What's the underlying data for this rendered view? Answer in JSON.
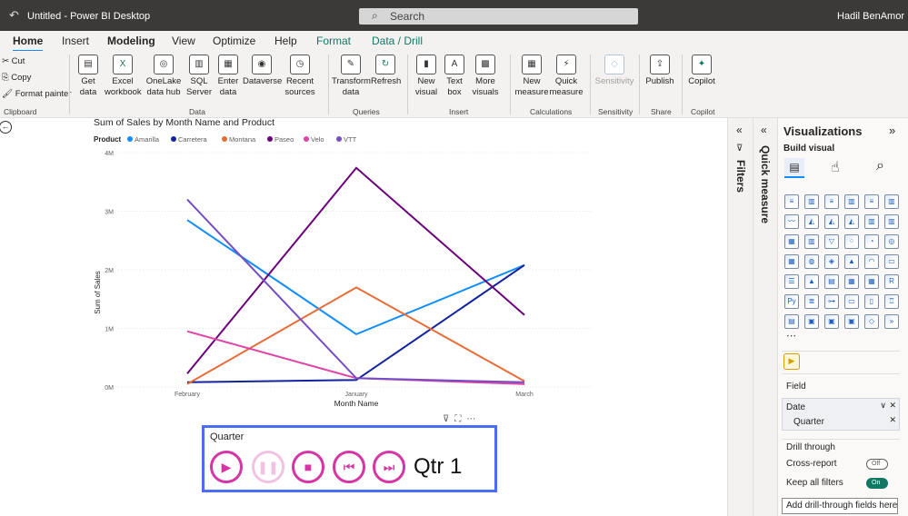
{
  "titlebar": {
    "title": "Untitled - Power BI Desktop",
    "search_placeholder": "Search",
    "user": "Hadil BenAmor"
  },
  "tabs": [
    "Home",
    "Insert",
    "Modeling",
    "View",
    "Optimize",
    "Help",
    "Format",
    "Data / Drill"
  ],
  "ribbon": {
    "clipboard": {
      "cut": "Cut",
      "copy": "Copy",
      "format_painter": "Format painter",
      "group": "Clipboard"
    },
    "data": {
      "get_data": "Get data",
      "excel": "Excel workbook",
      "onelake": "OneLake data hub",
      "sql": "SQL Server",
      "enter": "Enter data",
      "dataverse": "Dataverse",
      "recent": "Recent sources",
      "group": "Data"
    },
    "queries": {
      "transform": "Transform data",
      "refresh": "Refresh",
      "group": "Queries"
    },
    "insert": {
      "new_visual": "New visual",
      "text_box": "Text box",
      "more_visuals": "More visuals",
      "group": "Insert"
    },
    "calculations": {
      "new_measure": "New measure",
      "quick_measure": "Quick measure",
      "group": "Calculations"
    },
    "sensitivity": {
      "label": "Sensitivity",
      "group": "Sensitivity"
    },
    "share": {
      "publish": "Publish",
      "group": "Share"
    },
    "copilot": {
      "label": "Copilot",
      "group": "Copilot"
    }
  },
  "chart_data": {
    "type": "line",
    "title": "Sum of Sales by Month Name and Product",
    "legend_title": "Product",
    "legend_position": "top-left",
    "xlabel": "Month Name",
    "ylabel": "Sum of Sales",
    "categories": [
      "February",
      "January",
      "March"
    ],
    "ylim": [
      0,
      4000000
    ],
    "yticks": [
      {
        "v": 0,
        "label": "0M"
      },
      {
        "v": 1000000,
        "label": "1M"
      },
      {
        "v": 2000000,
        "label": "2M"
      },
      {
        "v": 3000000,
        "label": "3M"
      },
      {
        "v": 4000000,
        "label": "4M"
      }
    ],
    "grid": true,
    "series": [
      {
        "name": "Amarilla",
        "color": "#118dff",
        "values": [
          2850000,
          900000,
          2080000
        ]
      },
      {
        "name": "Carretera",
        "color": "#12239e",
        "values": [
          80000,
          120000,
          2080000
        ]
      },
      {
        "name": "Montana",
        "color": "#e66c37",
        "values": [
          50000,
          1700000,
          100000
        ]
      },
      {
        "name": "Paseo",
        "color": "#6b007b",
        "values": [
          230000,
          3740000,
          1230000
        ]
      },
      {
        "name": "Velo",
        "color": "#e044a7",
        "values": [
          950000,
          150000,
          50000
        ]
      },
      {
        "name": "VTT",
        "color": "#744ec2",
        "values": [
          3200000,
          150000,
          80000
        ]
      }
    ]
  },
  "slicer": {
    "label": "Quarter",
    "value": "Qtr 1"
  },
  "panes": {
    "filters": "Filters",
    "quick_measure": "Quick measure"
  },
  "visualizations": {
    "title": "Visualizations",
    "build_visual": "Build visual",
    "field_label": "Field",
    "fields": [
      "Date",
      "Quarter"
    ],
    "drill_through": "Drill through",
    "cross_report": "Cross-report",
    "cross_report_state": "Off",
    "keep_filters": "Keep all filters",
    "keep_filters_state": "On",
    "add_button": "Add drill-through fields here"
  }
}
